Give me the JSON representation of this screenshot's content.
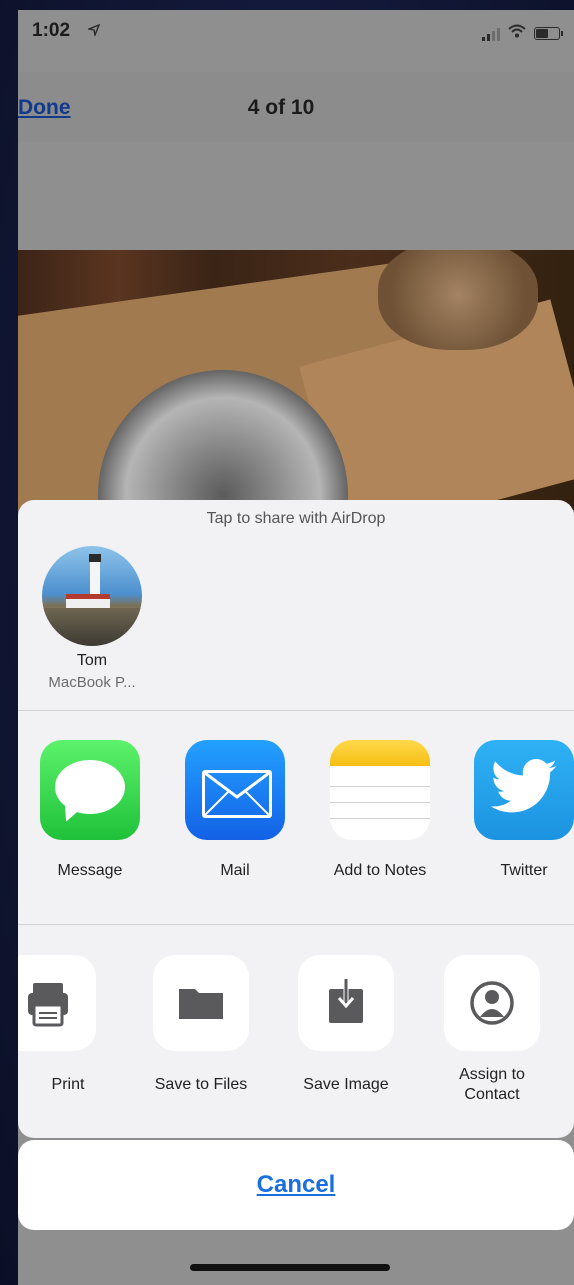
{
  "status_bar": {
    "time": "1:02"
  },
  "nav": {
    "done_label": "Done",
    "page_counter": "4 of 10"
  },
  "share_sheet": {
    "airdrop_hint": "Tap to share with AirDrop",
    "airdrop_person": {
      "name": "Tom",
      "device": "MacBook P..."
    },
    "apps": [
      {
        "label": "Message",
        "icon": "messages-icon"
      },
      {
        "label": "Mail",
        "icon": "mail-icon"
      },
      {
        "label": "Add to Notes",
        "icon": "notes-icon"
      },
      {
        "label": "Twitter",
        "icon": "twitter-icon"
      }
    ],
    "actions": [
      {
        "label": "Print",
        "icon": "printer-icon"
      },
      {
        "label": "Save to Files",
        "icon": "folder-icon"
      },
      {
        "label": "Save Image",
        "icon": "save-image-icon"
      },
      {
        "label": "Assign to Contact",
        "icon": "contact-icon"
      }
    ]
  },
  "cancel_label": "Cancel",
  "colors": {
    "accent": "#1a6fe0",
    "sheet": "#f2f2f4",
    "background": "#141a3c"
  }
}
